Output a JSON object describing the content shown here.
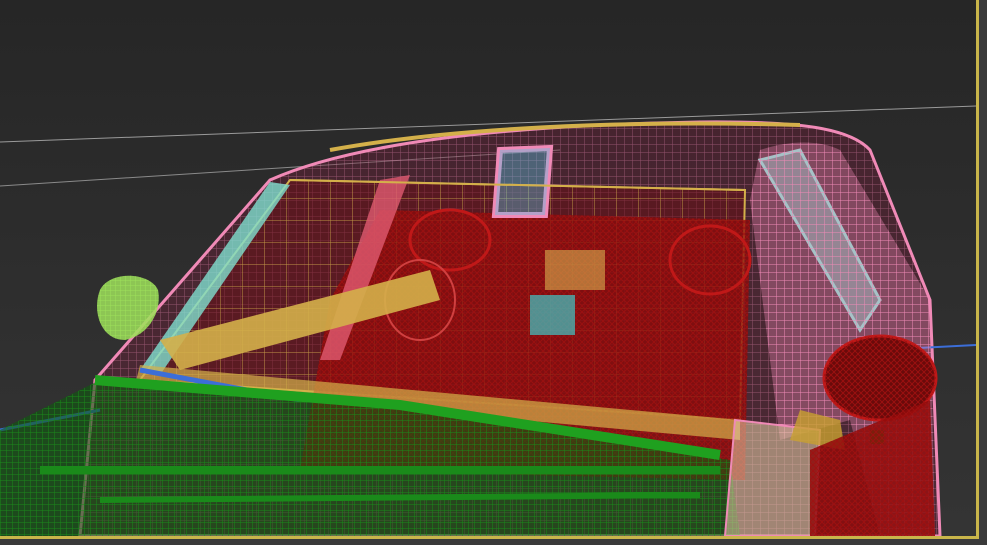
{
  "viewport": {
    "mode": "wireframe",
    "background": "#2b2b2b",
    "selection_border_color": "#c9b54a",
    "object_colors": {
      "body_shell": "#f08ab7",
      "interior": "#8e0b0b",
      "bumper": "#1a8a1a",
      "trim": "#d4b04a",
      "mirror_left": "#9de05a",
      "window_frame": "#7fe0d0",
      "details": "#3c6ed8"
    }
  }
}
